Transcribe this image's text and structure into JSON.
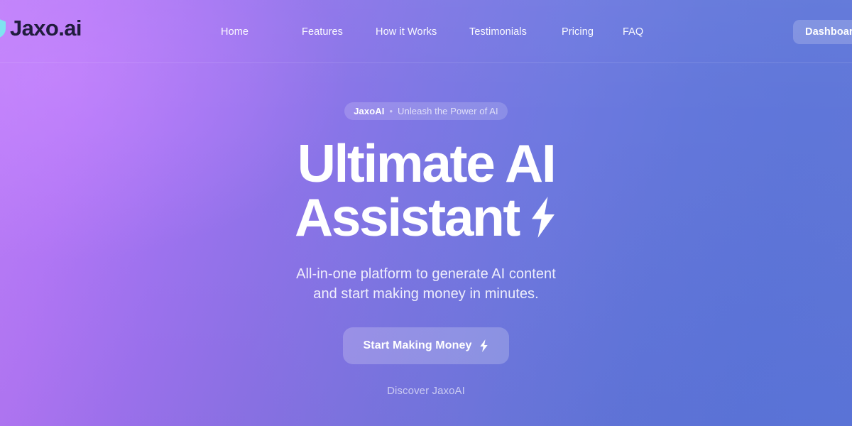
{
  "colors": {
    "gradient_left": "#bd7ef9",
    "gradient_right": "#6077d8",
    "logo_text": "#201c3d",
    "logo_mark": "#7fe3f0",
    "text_on_dark": "#ffffff"
  },
  "header": {
    "brand": {
      "name": "Jaxo.ai",
      "mark_icon": "shield-logo-mark"
    },
    "nav": [
      {
        "label": "Home"
      },
      {
        "label": "Features"
      },
      {
        "label": "How it Works"
      },
      {
        "label": "Testimonials"
      },
      {
        "label": "Pricing"
      },
      {
        "label": "FAQ"
      }
    ],
    "dashboard_button": "Dashboard"
  },
  "hero": {
    "badge": {
      "brand": "JaxoAI",
      "separator": "•",
      "text": "Unleash the Power of AI"
    },
    "headline_line1": "Ultimate AI",
    "headline_line2": "Assistant",
    "headline_icon": "lightning-bolt-icon",
    "subhead_line1": "All-in-one platform to generate AI content",
    "subhead_line2": "and start making money in minutes.",
    "cta_label": "Start Making Money",
    "cta_icon": "lightning-bolt-icon",
    "discover_link": "Discover JaxoAI"
  }
}
